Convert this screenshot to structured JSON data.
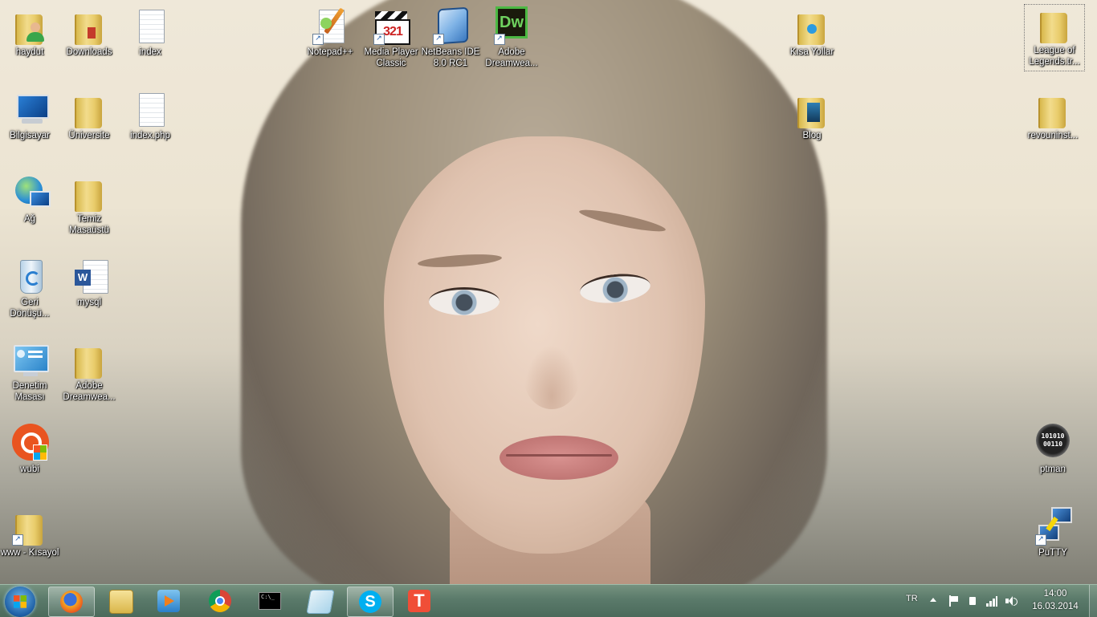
{
  "desktop": {
    "icons_left": [
      {
        "label": "haydut",
        "icon": "user-folder-icon"
      },
      {
        "label": "Downloads",
        "icon": "downloads-folder-icon"
      },
      {
        "label": "index",
        "icon": "document-icon"
      },
      {
        "label": "Bilgisayar",
        "icon": "computer-icon"
      },
      {
        "label": "Üniversite",
        "icon": "folder-icon"
      },
      {
        "label": "index.php",
        "icon": "document-icon"
      },
      {
        "label": "Ağ",
        "icon": "network-icon"
      },
      {
        "label": "Temiz Masaüstü",
        "icon": "folder-icon"
      },
      {
        "label": "Geri Dönüşü...",
        "icon": "recycle-bin-icon"
      },
      {
        "label": "mysql",
        "icon": "word-document-icon"
      },
      {
        "label": "Denetim Masası",
        "icon": "control-panel-icon"
      },
      {
        "label": "Adobe Dreamwea...",
        "icon": "folder-icon"
      },
      {
        "label": "wubi",
        "icon": "ubuntu-icon"
      },
      {
        "label": "www - Kısayol",
        "icon": "folder-shortcut-icon"
      }
    ],
    "icons_top": [
      {
        "label": "Notepad++",
        "icon": "notepad-plus-plus-icon"
      },
      {
        "label": "Media Player Classic",
        "icon": "media-player-classic-icon"
      },
      {
        "label": "NetBeans IDE 8.0 RC1",
        "icon": "netbeans-icon"
      },
      {
        "label": "Adobe Dreamwea...",
        "icon": "dreamweaver-icon"
      }
    ],
    "icons_right": [
      {
        "label": "Kısa Yollar",
        "icon": "folder-icon"
      },
      {
        "label": "League of Legends.tr...",
        "icon": "folder-icon"
      },
      {
        "label": "Blog",
        "icon": "folder-icon"
      },
      {
        "label": "revouninst...",
        "icon": "folder-icon"
      },
      {
        "label": "ptman",
        "icon": "binary-disc-icon"
      },
      {
        "label": "PuTTY",
        "icon": "putty-icon"
      }
    ],
    "dw_glyph": "Dw",
    "mpc_glyph": "321",
    "ptman_glyph": "101010\n00110"
  },
  "taskbar": {
    "pinned": [
      {
        "name": "firefox",
        "active": true
      },
      {
        "name": "windows-explorer",
        "active": false
      },
      {
        "name": "media-player",
        "active": false
      },
      {
        "name": "chrome",
        "active": false
      },
      {
        "name": "command-prompt",
        "active": false
      },
      {
        "name": "notes",
        "active": false
      },
      {
        "name": "skype",
        "active": true
      },
      {
        "name": "t-app",
        "active": false
      }
    ],
    "cmd_glyph": "C:\\_",
    "skype_glyph": "S",
    "t_glyph": "T",
    "tray": {
      "language": "TR",
      "time": "14:00",
      "date": "16.03.2014"
    }
  },
  "colors": {
    "taskbar": "#4b6a5b",
    "dreamweaver_green": "#4cb843",
    "chrome_red": "#db4437",
    "skype_blue": "#00aff0",
    "t_orange": "#f04e37"
  }
}
